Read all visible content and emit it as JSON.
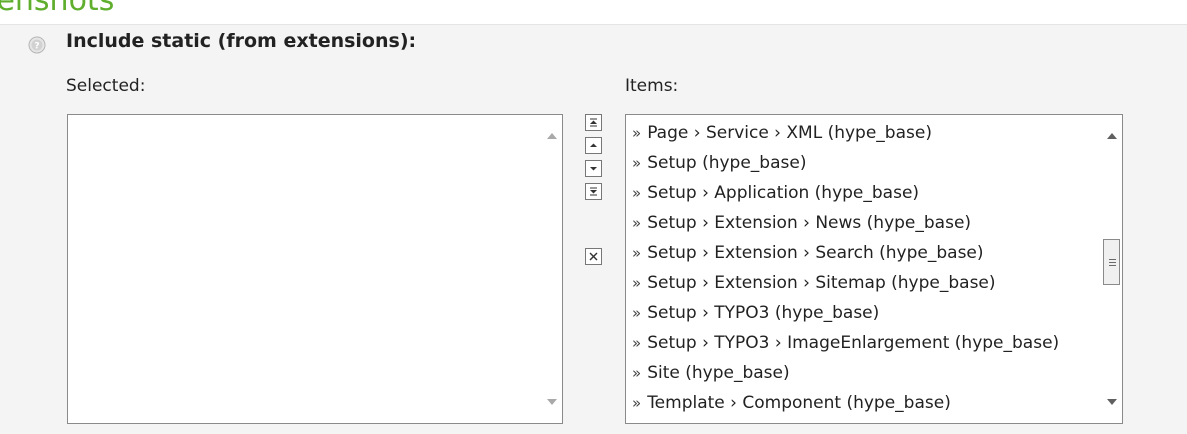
{
  "section": {
    "title": "eenshots"
  },
  "field": {
    "label": "Include static (from extensions):",
    "icon": "help-icon"
  },
  "selected": {
    "label": "Selected:",
    "items": []
  },
  "items": {
    "label": "Items:",
    "prefix": "»",
    "list": [
      "Page › Service › XML (hype_base)",
      "Setup (hype_base)",
      "Setup › Application (hype_base)",
      "Setup › Extension › News (hype_base)",
      "Setup › Extension › Search (hype_base)",
      "Setup › Extension › Sitemap (hype_base)",
      "Setup › TYPO3 (hype_base)",
      "Setup › TYPO3 › ImageEnlargement (hype_base)",
      "Site (hype_base)",
      "Template › Component (hype_base)"
    ]
  },
  "controls": [
    {
      "name": "move-to-top-button",
      "icon": "move-top-icon"
    },
    {
      "name": "move-up-button",
      "icon": "move-up-icon"
    },
    {
      "name": "move-down-button",
      "icon": "move-down-icon"
    },
    {
      "name": "move-to-bottom-button",
      "icon": "move-bottom-icon"
    },
    {
      "name": "remove-selected-button",
      "icon": "remove-icon"
    }
  ],
  "colors": {
    "section_title": "#5fae2e",
    "panel_background": "#f4f4f4",
    "list_border": "#8a8a8a"
  }
}
